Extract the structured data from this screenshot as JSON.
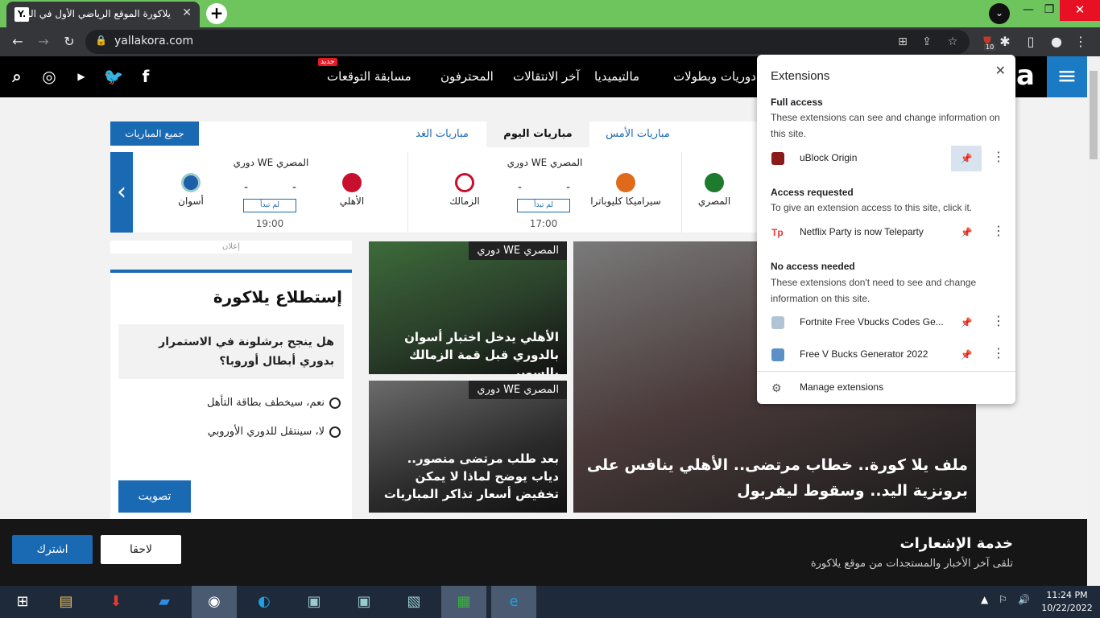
{
  "browser": {
    "tab_title": "يلاكورة الموقع الرياضي الأول في الو",
    "tab_favicon": "Y.",
    "url": "yallakora.com",
    "extensions_badge": "10"
  },
  "site_nav": {
    "new_badge": "جديد",
    "items": [
      "مسابقة التوقعات",
      "المحترفون",
      "آخر الانتقالات",
      "مالتيميديا",
      "دوريات وبطولات"
    ],
    "logo_fragment": "a"
  },
  "matches": {
    "all_matches": "جميع المباريات",
    "tabs": [
      "مباريات الأمس",
      "مباريات اليوم",
      "مباريات الغد"
    ],
    "cards": [
      {
        "league": "دوري WE المصري",
        "home": "الأهلي",
        "away": "أسوان",
        "home_score": "-",
        "away_score": "-",
        "status": "لم تبدأ",
        "time": "19:00"
      },
      {
        "league": "دوري WE المصري",
        "home": "سيراميكا كليوباترا",
        "away": "الزمالك",
        "home_score": "-",
        "away_score": "-",
        "status": "لم تبدأ",
        "time": "17:00"
      },
      {
        "league": "",
        "home": "المصري",
        "away": "",
        "home_score": "",
        "away_score": "",
        "status": "",
        "time": ""
      }
    ]
  },
  "ad_label": "إعلان",
  "poll": {
    "title": "إستطلاع يلاكورة",
    "question": "هل ينجح برشلونة في الاستمرار بدوري أبطال أوروبا؟",
    "options": [
      "نعم، سيخطف بطاقة التأهل",
      "لا، سينتقل للدوري الأوروبي"
    ],
    "vote": "تصويت"
  },
  "news": [
    {
      "tag": "دوري WE المصري",
      "title": "الأهلي يدخل اختبار أسوان بالدوري قبل قمة الزمالك بالسوبر"
    },
    {
      "tag": "دوري WE المصري",
      "title": "بعد طلب مرتضى منصور.. دياب يوضح لماذا لا يمكن تخفيض أسعار تذاكر المباريات"
    },
    {
      "tag": "",
      "title": "ملف يلا كورة.. خطاب مرتضى.. الأهلي ينافس على برونزية اليد.. وسقوط ليفربول"
    }
  ],
  "notification": {
    "title": "خدمة الإشعارات",
    "subtitle": "تلقى آخر الأخبار والمستجدات من موقع يلاكورة",
    "subscribe": "اشترك",
    "later": "لاحقا"
  },
  "extensions_popup": {
    "title": "Extensions",
    "full_access": "Full access",
    "full_access_desc": "These extensions can see and change information on this site.",
    "requested": "Access requested",
    "requested_desc": "To give an extension access to this site, click it.",
    "no_access": "No access needed",
    "no_access_desc": "These extensions don't need to see and change information on this site.",
    "items": [
      "uBlock Origin",
      "Netflix Party is now Teleparty",
      "Fortnite Free Vbucks Codes Ge...",
      "Free V Bucks Generator 2022"
    ],
    "manage": "Manage extensions"
  },
  "taskbar": {
    "time": "11:24 PM",
    "date": "10/22/2022"
  },
  "colors": {
    "accent": "#1a69b3",
    "tabstrip": "#6ec55e",
    "dark": "#35363a"
  }
}
